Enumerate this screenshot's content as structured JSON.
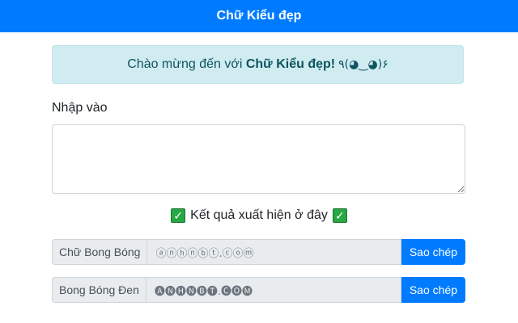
{
  "navbar": {
    "brand": "Chữ Kiểu đẹp"
  },
  "alert": {
    "prefix": "Chào mừng đến với ",
    "name": "Chữ Kiểu đẹp!",
    "emoji": "٩(◕‿◕)۶"
  },
  "input": {
    "label": "Nhập vào",
    "value": "",
    "placeholder": ""
  },
  "result": {
    "heading": "Kết quả xuất hiện ở đây",
    "check_icon": "✓"
  },
  "outputs": [
    {
      "label": "Chữ Bong Bóng",
      "value": "ⓐⓝⓗⓝⓑⓣ.ⓒⓞⓜ",
      "button": "Sao chép"
    },
    {
      "label": "Bong Bóng Đen",
      "value": "🅐🅝🅗🅝🅑🅣.🅒🅞🅜",
      "button": "Sao chép"
    }
  ],
  "colors": {
    "primary": "#007bff",
    "alert_bg": "#d1ecf1",
    "check_green": "#28a745"
  }
}
